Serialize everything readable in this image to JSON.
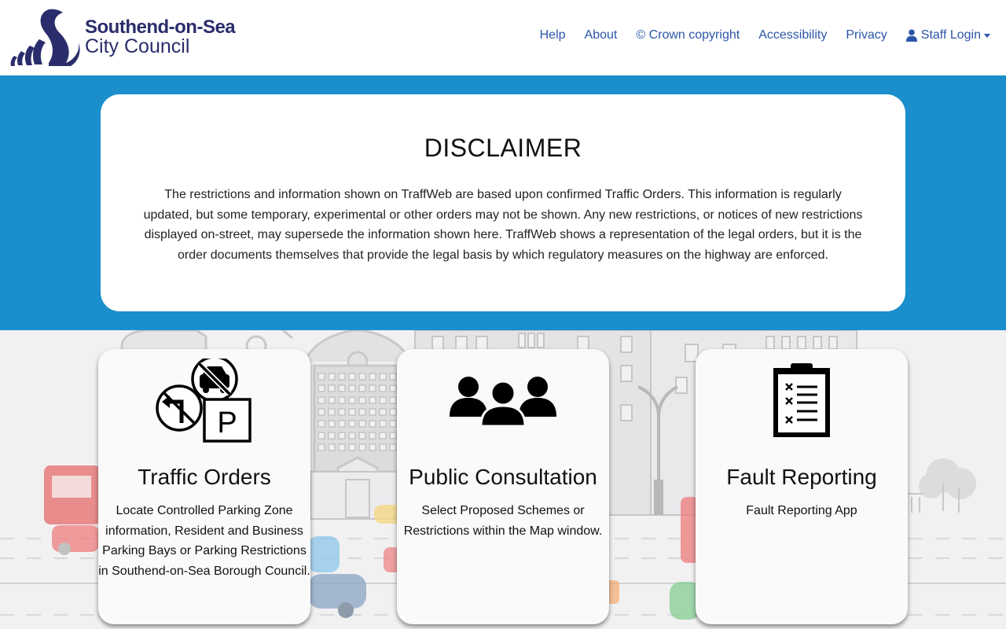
{
  "header": {
    "logo": {
      "line1": "Southend-on-Sea",
      "line2": "City Council",
      "brand_color": "#2a2d6b"
    },
    "nav": [
      {
        "label": "Help"
      },
      {
        "label": "About"
      },
      {
        "label": "© Crown copyright"
      },
      {
        "label": "Accessibility"
      },
      {
        "label": "Privacy"
      },
      {
        "label": "Staff Login",
        "icon": "user-icon",
        "dropdown": true
      }
    ],
    "link_color": "#2b56a8"
  },
  "banner": {
    "background_color": "#1a8fcc",
    "title": "DISCLAIMER",
    "text": "The restrictions and information shown on TraffWeb are based upon confirmed Traffic Orders. This information is regularly updated, but some temporary, experimental or other orders may not be shown. Any new restrictions, or notices of new restrictions displayed on-street, may supersede the information shown here. TraffWeb shows a representation of the legal orders, but it is the order documents themselves that provide the legal basis by which regulatory measures on the highway are enforced."
  },
  "cards": [
    {
      "title": "Traffic Orders",
      "text": "Locate Controlled Parking Zone information, Resident and Business Parking Bays or Parking Restrictions in Southend-on-Sea Borough Council.",
      "icon": "traffic-signs-icon"
    },
    {
      "title": "Public Consultation",
      "text": "Select Proposed Schemes or Restrictions within the Map window.",
      "icon": "people-group-icon"
    },
    {
      "title": "Fault Reporting",
      "text": "Fault Reporting App",
      "icon": "clipboard-checklist-icon"
    }
  ]
}
